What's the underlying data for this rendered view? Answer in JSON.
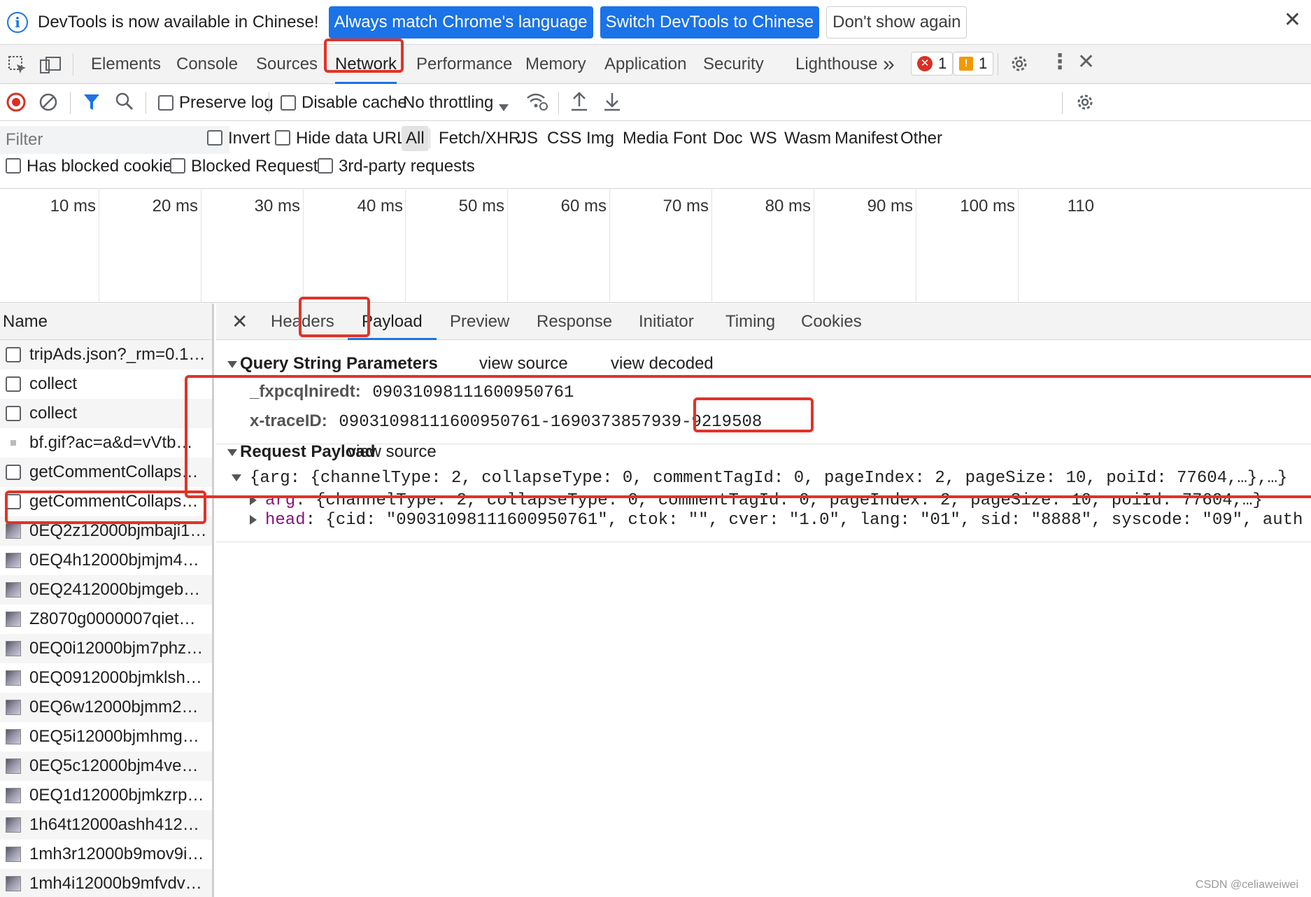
{
  "infobar": {
    "message": "DevTools is now available in Chinese!",
    "btn_match": "Always match Chrome's language",
    "btn_switch": "Switch DevTools to Chinese",
    "btn_dismiss": "Don't show again"
  },
  "tabs": {
    "elements": "Elements",
    "console": "Console",
    "sources": "Sources",
    "network": "Network",
    "performance": "Performance",
    "memory": "Memory",
    "application": "Application",
    "security": "Security",
    "lighthouse": "Lighthouse",
    "more": "»",
    "error_count": "1",
    "warning_count": "1"
  },
  "toolbar": {
    "preserve_log": "Preserve log",
    "disable_cache": "Disable cache",
    "throttling": "No throttling"
  },
  "filter": {
    "placeholder": "Filter",
    "invert": "Invert",
    "hide_data_urls": "Hide data URLs",
    "types": [
      "All",
      "Fetch/XHR",
      "JS",
      "CSS",
      "Img",
      "Media",
      "Font",
      "Doc",
      "WS",
      "Wasm",
      "Manifest",
      "Other"
    ],
    "has_blocked_cookies": "Has blocked cookies",
    "blocked_requests": "Blocked Requests",
    "third_party": "3rd-party requests"
  },
  "timeline": {
    "ticks": [
      "10 ms",
      "20 ms",
      "30 ms",
      "40 ms",
      "50 ms",
      "60 ms",
      "70 ms",
      "80 ms",
      "90 ms",
      "100 ms",
      "110"
    ]
  },
  "requests": {
    "header": "Name",
    "items": [
      "tripAds.json?_rm=0.1…",
      "collect",
      "collect",
      "bf.gif?ac=a&d=vVtb…",
      "getCommentCollaps…",
      "getCommentCollaps…",
      "0EQ2z12000bjmbaji1…",
      "0EQ4h12000bjmjm4…",
      "0EQ2412000bjmgeb…",
      "Z8070g0000007qiet…",
      "0EQ0i12000bjm7phz…",
      "0EQ0912000bjmklsh…",
      "0EQ6w12000bjmm2…",
      "0EQ5i12000bjmhmg…",
      "0EQ5c12000bjm4ve…",
      "0EQ1d12000bjmkzrp…",
      "1h64t12000ashh412…",
      "1mh3r12000b9mov9i…",
      "1mh4i12000b9mfvdv…"
    ]
  },
  "detail": {
    "tabs": {
      "headers": "Headers",
      "payload": "Payload",
      "preview": "Preview",
      "response": "Response",
      "initiator": "Initiator",
      "timing": "Timing",
      "cookies": "Cookies"
    },
    "query": {
      "title": "Query String Parameters",
      "view_source": "view source",
      "view_decoded": "view decoded",
      "params": [
        {
          "key": "_fxpcqlniredt:",
          "value": "09031098111600950761"
        },
        {
          "key": "x-traceID:",
          "value": "09031098111600950761-1690373857939-9219508"
        }
      ]
    },
    "payload": {
      "title": "Request Payload",
      "view_source": "view source",
      "summary_a": "{arg: {channelType: 2, collapseType: 0, commentTagId: 0, ",
      "summary_highlight": "pageIndex: 2,",
      "summary_b": " pageSize: 10, poiId: 77604,…},…}",
      "arg_key": "arg",
      "arg_val": ": {channelType: 2, collapseType: 0, commentTagId: 0, pageIndex: 2, pageSize: 10, poiId: 77604,…}",
      "head_key": "head",
      "head_val": ": {cid: \"09031098111600950761\", ctok: \"\", cver: \"1.0\", lang: \"01\", sid: \"8888\", syscode: \"09\", auth"
    }
  },
  "watermark": "CSDN @celiaweiwei",
  "colors": {
    "accent": "#1a73e8",
    "highlight_box": "#e03327"
  }
}
